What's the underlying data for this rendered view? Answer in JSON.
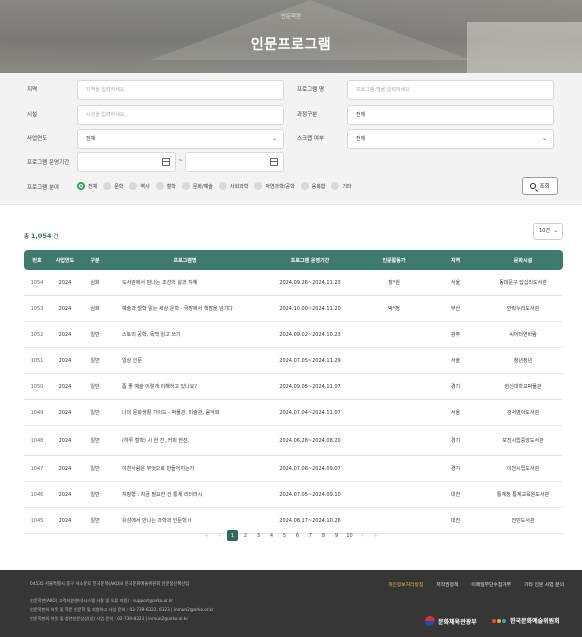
{
  "hero": {
    "breadcrumb": "인문학판",
    "title": "인문프로그램"
  },
  "filters": {
    "region_label": "지역",
    "region_placeholder": "지역을 입력하세요.",
    "program_name_label": "프로그램 명",
    "program_name_placeholder": "프로그램 명을 입력하세요.",
    "city_label": "시설",
    "city_placeholder": "시설을 입력하세요.",
    "course_label": "과정구분",
    "course_value": "전체",
    "year_label": "사업연도",
    "year_value": "전체",
    "scrap_label": "스크랩 여부",
    "scrap_value": "전체",
    "period_label": "프로그램 운영기간",
    "period_sep": "~",
    "field_label": "프로그램 분야",
    "fields": [
      "전체",
      "문학",
      "역사",
      "철학",
      "문화/예술",
      "사회과학",
      "자연과학/공학",
      "융복합",
      "기타"
    ],
    "selected_field": "전체",
    "search_button": "조회"
  },
  "results": {
    "total_prefix": "총",
    "total_count": "1,054",
    "total_suffix": "건",
    "page_size": "10건",
    "columns": [
      "번호",
      "사업연도",
      "구분",
      "프로그램명",
      "프로그램 운영기간",
      "인문활동가",
      "지역",
      "문화시설"
    ],
    "rows": [
      {
        "no": "1054",
        "year": "2024",
        "type": "심화",
        "title": "도서관에서 만나는 조선의 삶과 지혜",
        "period": "2024.09.26~2024.11.23",
        "activist": "장*원",
        "region": "서울",
        "facility": "동대문구 답십리도서관"
      },
      {
        "no": "1053",
        "year": "2024",
        "type": "심화",
        "title": "예술과 철학 읽는 세상 문학 · 극장에서 책장을 넘기다",
        "period": "2024.10.00~2024.11.20",
        "activist": "박*정",
        "region": "부산",
        "facility": "안락누리도서관"
      },
      {
        "no": "1052",
        "year": "2024",
        "type": "일반",
        "title": "스토리 공학, 독백 읽고 쓰기",
        "period": "2024.09.02~2024.10.23",
        "activist": "",
        "region": "광주",
        "facility": "씨어터연바람"
      },
      {
        "no": "1051",
        "year": "2024",
        "type": "일반",
        "title": "일상 인문",
        "period": "2024.07.05~2024.11.29",
        "activist": "",
        "region": "서울",
        "facility": "청년정년"
      },
      {
        "no": "1050",
        "year": "2024",
        "type": "일반",
        "title": "좀 좋 예술 이렇게 이해하고 있나요?",
        "period": "2024.09.05~2024.11.07",
        "activist": "",
        "region": "경기",
        "facility": "한신대학교박물관"
      },
      {
        "no": "1049",
        "year": "2024",
        "type": "일반",
        "title": "나의 문화생활 가이드 - 박물관, 미술관, 음악회",
        "period": "2024.07.04~2024.11.07",
        "activist": "",
        "region": "서울",
        "facility": "강서영어도서관"
      },
      {
        "no": "1048",
        "year": "2024",
        "type": "일반",
        "title": "(하루 철학) 시 한 잔, 커피 한잔,",
        "period": "2024.06.28~2024.08.20",
        "activist": "",
        "region": "경기",
        "facility": "포천시립중앙도서관"
      },
      {
        "no": "1047",
        "year": "2024",
        "type": "일반",
        "title": "이천사람은 무엇으로 만들어지는가",
        "period": "2024.07.06~2024.09.07",
        "activist": "",
        "region": "경기",
        "facility": "이천시립도서관"
      },
      {
        "no": "1046",
        "year": "2024",
        "type": "일반",
        "title": "지팡형 : 지금 필요한 건 통계 리터러시",
        "period": "2024.07.05~2024.09.10",
        "activist": "",
        "region": "대전",
        "facility": "통계청 통계교육원도서관"
      },
      {
        "no": "1045",
        "year": "2024",
        "type": "일반",
        "title": "유성에서 만나는 과학과 인문학 II",
        "period": "2024.08.17~2024.10.26",
        "activist": "",
        "region": "대전",
        "facility": "전민도서관"
      }
    ]
  },
  "pagination": {
    "first": "«",
    "prev": "‹",
    "pages": [
      "1",
      "2",
      "3",
      "4",
      "5",
      "6",
      "7",
      "8",
      "9",
      "10"
    ],
    "current": "1",
    "next": "›",
    "last": "»"
  },
  "footer": {
    "address": "04535 서울특별시 중구 서소문로 한국문학(AKO)II 한국문화예술위원회 인문정신확산팀",
    "links": [
      "개인정보처리방침",
      "저작권정책",
      "이메일무단수집거부",
      "기타 인문 사업 문의"
    ],
    "info1": "인문학판(AKO) 고객지원센터(시스템 사용 및 오류 지원) : support@arko.or.kr",
    "info2": "인문학판의 아웃 및 학문 인문학 및 지원하고 사업 문의 : 02-739-6322, 6323 | inmun2@arko.or.kr",
    "info3": "인문학판의 아웃 및 청년인문상상(상) 사업 문의 : 02-739-8323 | inmun2@arko.or.kr",
    "logo1": "문화체육관광부",
    "logo2": "한국문화예술위원회",
    "colors": {
      "highlight": "#e3b73a",
      "brand": "#3e7a6e"
    }
  }
}
